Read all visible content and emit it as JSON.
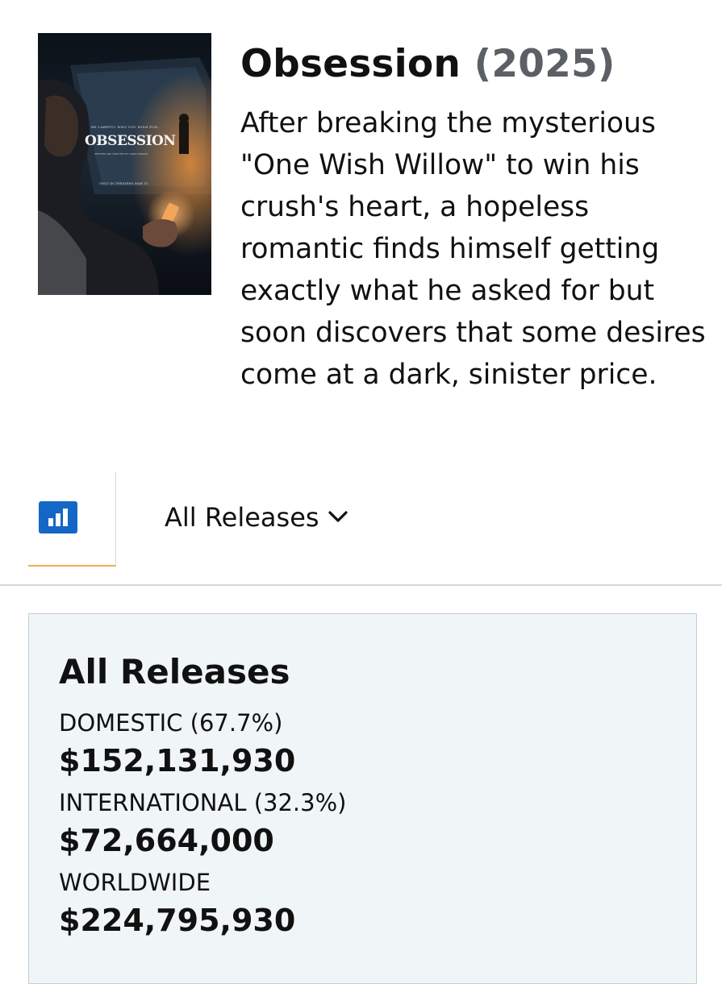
{
  "movie": {
    "title": "Obsession",
    "year": "(2025)",
    "synopsis": "After breaking the mysterious \"One Wish Willow\" to win his crush's heart, a hopeless romantic finds himself getting exactly what he asked for but soon discovers that some desires come at a dark, sinister price.",
    "poster": {
      "title_text": "OBSESSION",
      "tagline": "BE CAREFUL WHO YOU WISH FOR...",
      "credit_line": "WRITTEN AND DIRECTED BY CURRY BARKER",
      "release_line": "ONLY IN THEATERS MAR 15"
    }
  },
  "tabs": {
    "chart_icon": "bar-chart-icon",
    "release_selector": {
      "label": "All Releases",
      "icon": "chevron-down-icon"
    }
  },
  "summary": {
    "heading": "All Releases",
    "domestic_label": "DOMESTIC (67.7%)",
    "domestic_value": "$152,131,930",
    "international_label": "INTERNATIONAL (32.3%)",
    "international_value": "$72,664,000",
    "worldwide_label": "WORLDWIDE",
    "worldwide_value": "$224,795,930"
  },
  "colors": {
    "accent_blue": "#1467c7",
    "tab_underline": "#e8b14c",
    "panel_background": "#f0f6f8",
    "year_gray": "#5b5f66"
  }
}
